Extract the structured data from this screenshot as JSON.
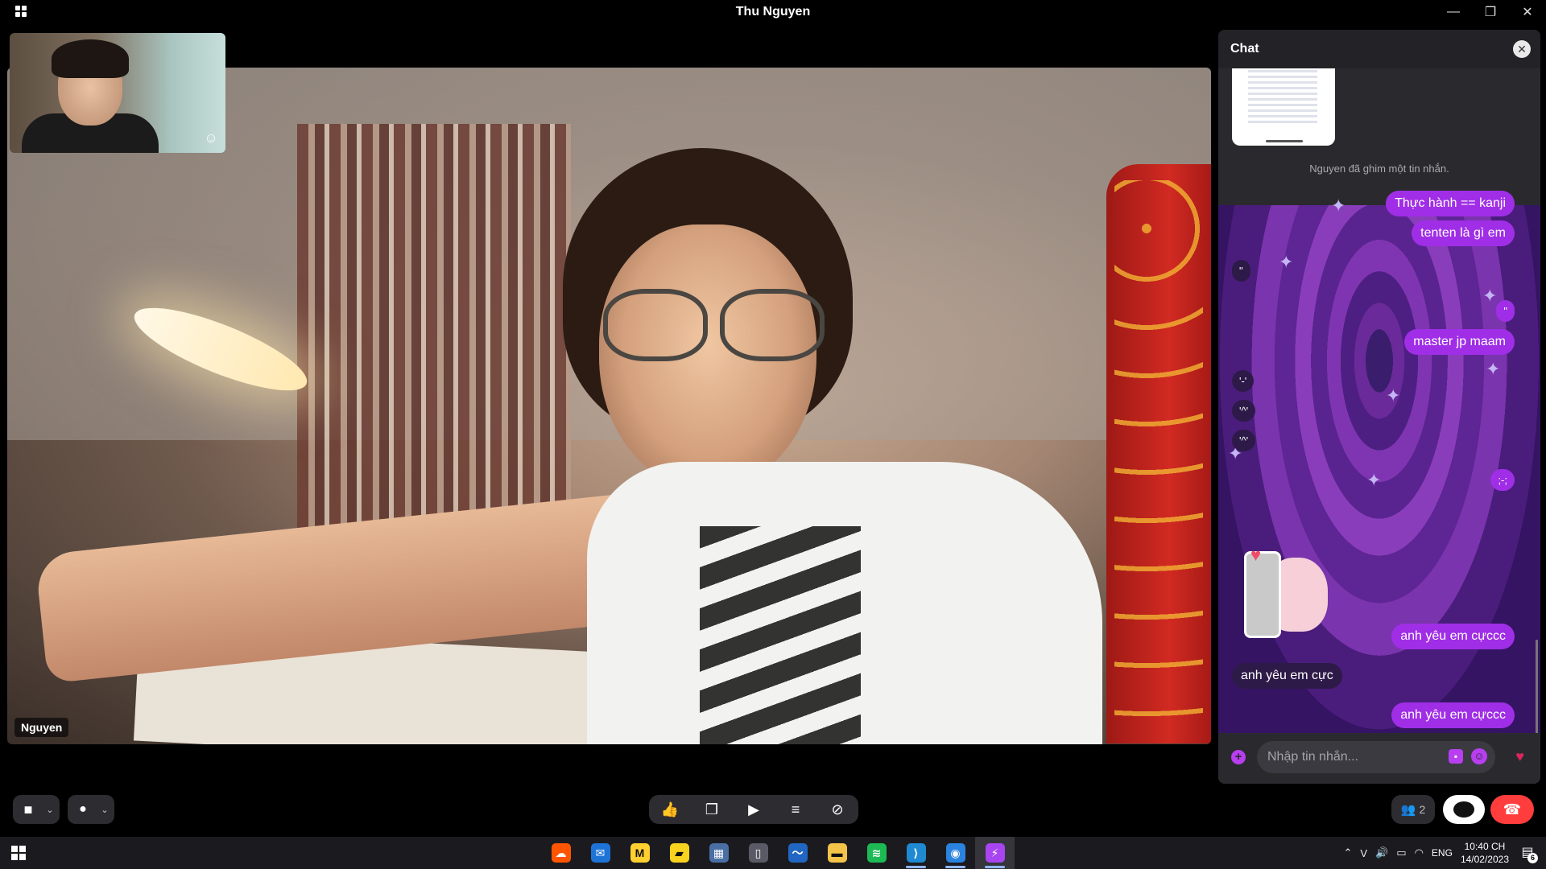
{
  "window": {
    "title": "Thu Nguyen",
    "minimize_icon": "—",
    "restore_icon": "❐",
    "close_icon": "✕"
  },
  "main_video": {
    "participant_name": "Nguyen"
  },
  "chat": {
    "title": "Chat",
    "close_icon": "✕",
    "pinned_note": "Nguyen đã ghim một tin nhắn.",
    "messages": [
      {
        "text": "Thực hành == kanji",
        "dir": "out"
      },
      {
        "text": "tenten là gì em",
        "dir": "out"
      },
      {
        "text": "\"",
        "dir": "in"
      },
      {
        "text": "\"",
        "dir": "out"
      },
      {
        "text": "master jp maam",
        "dir": "out"
      },
      {
        "text": "'-'",
        "dir": "in"
      },
      {
        "text": "'^'",
        "dir": "in"
      },
      {
        "text": "'^'",
        "dir": "in"
      },
      {
        "text": ";-;",
        "dir": "out"
      },
      {
        "text": "anh yêu em cựccc",
        "dir": "out"
      },
      {
        "text": "anh yêu em cực",
        "dir": "in"
      },
      {
        "text": "anh yêu em cựccc",
        "dir": "out"
      }
    ],
    "input_placeholder": "Nhập tin nhắn...",
    "plus_icon": "+",
    "sticker_icon": "▪",
    "emoji_icon": "☺",
    "heart_icon": "♥"
  },
  "controls": {
    "camera_icon": "■",
    "mic_icon": "●",
    "chevron": "⌄",
    "like_icon": "👍",
    "effects_icon": "❐",
    "share_icon": "▶",
    "activity_icon": "≡",
    "mute_all_icon": "⊘",
    "participants_count": "2",
    "participants_icon": "👥",
    "end_call_icon": "☎"
  },
  "taskbar": {
    "apps": [
      {
        "name": "soundcloud",
        "glyph": "☁",
        "color": "#ff5500"
      },
      {
        "name": "mail",
        "glyph": "✉",
        "color": "#1e74d6"
      },
      {
        "name": "miro",
        "glyph": "M",
        "color": "#ffd02f"
      },
      {
        "name": "sticky-notes",
        "glyph": "▰",
        "color": "#f7d21e"
      },
      {
        "name": "calculator",
        "glyph": "▦",
        "color": "#4a6fa5"
      },
      {
        "name": "phone-link",
        "glyph": "▯",
        "color": "#5a5a66"
      },
      {
        "name": "whiteboard",
        "glyph": "〜",
        "color": "#2166c3"
      },
      {
        "name": "file-explorer",
        "glyph": "▬",
        "color": "#f4c34a"
      },
      {
        "name": "spotify",
        "glyph": "≋",
        "color": "#1db954"
      },
      {
        "name": "vscode",
        "glyph": "⟩",
        "color": "#1f8ad2"
      },
      {
        "name": "firefox",
        "glyph": "◉",
        "color": "#2b83e0"
      },
      {
        "name": "messenger",
        "glyph": "⚡",
        "color": "#a845f0"
      }
    ],
    "tray_chevron": "⌃",
    "tray_v": "V",
    "tray_volume": "🔊",
    "tray_battery": "▭",
    "tray_wifi": "◠",
    "language": "ENG",
    "time": "10:40 CH",
    "date": "14/02/2023",
    "notification_count": "6",
    "notification_icon": "▤"
  }
}
